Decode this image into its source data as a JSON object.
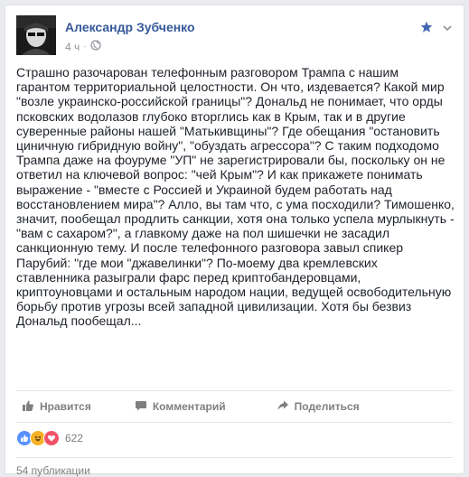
{
  "post": {
    "author": "Александр Зубченко",
    "time": "4 ч",
    "text": "Страшно разочарован телефонным разговором Трампа с нашим гарантом территориальной целостности. Он что, издевается? Какой мир \"возле украинско-российской границы\"? Дональд не понимает, что орды псковских водолазов глубоко вторглись как в Крым, так и в другие суверенные районы нашей \"Матькивщины\"? Где обещания \"остановить циничную гибридную войну\", \"обуздать агрессора\"? С таким подходомо Трампа даже на фоуруме \"УП\" не зарегистрировали бы, поскольку он не ответил на ключевой вопрос: \"чей Крым\"? И как прикажете понимать выражение - \"вместе с Россией и Украиной будем работать над восстановлением мира\"? Алло, вы там что, с ума посходили? Тимошенко, значит, пообещал продлить санкции, хотя она только успела мурлыкнуть - \"вам с сахаром?\", а главкому даже на пол шишечки не засадил санкционную тему. И после телефонного разговора завыл спикер Парубий: \"где мои \"джавелинки\"? По-моему два кремлевских ставленника разыграли фарс перед криптобандеровцами, криптоуновцами и остальным народом нации, ведущей освободительную борьбу против угрозы всей западной цивилизации. Хотя бы безвиз Дональд пообещал..."
  },
  "actions": {
    "like": "Нравится",
    "comment": "Комментарий",
    "share": "Поделиться"
  },
  "reactions": {
    "count": "622",
    "icons": [
      "like-icon",
      "haha-icon",
      "love-icon"
    ]
  },
  "shares": "54 публикации",
  "colors": {
    "author": "#365899",
    "meta": "#90949c",
    "text": "#1d2129",
    "action": "#7f7f7f",
    "like_blue": "#5890ff",
    "haha_yellow": "#f7b125",
    "love_red": "#f25268"
  }
}
